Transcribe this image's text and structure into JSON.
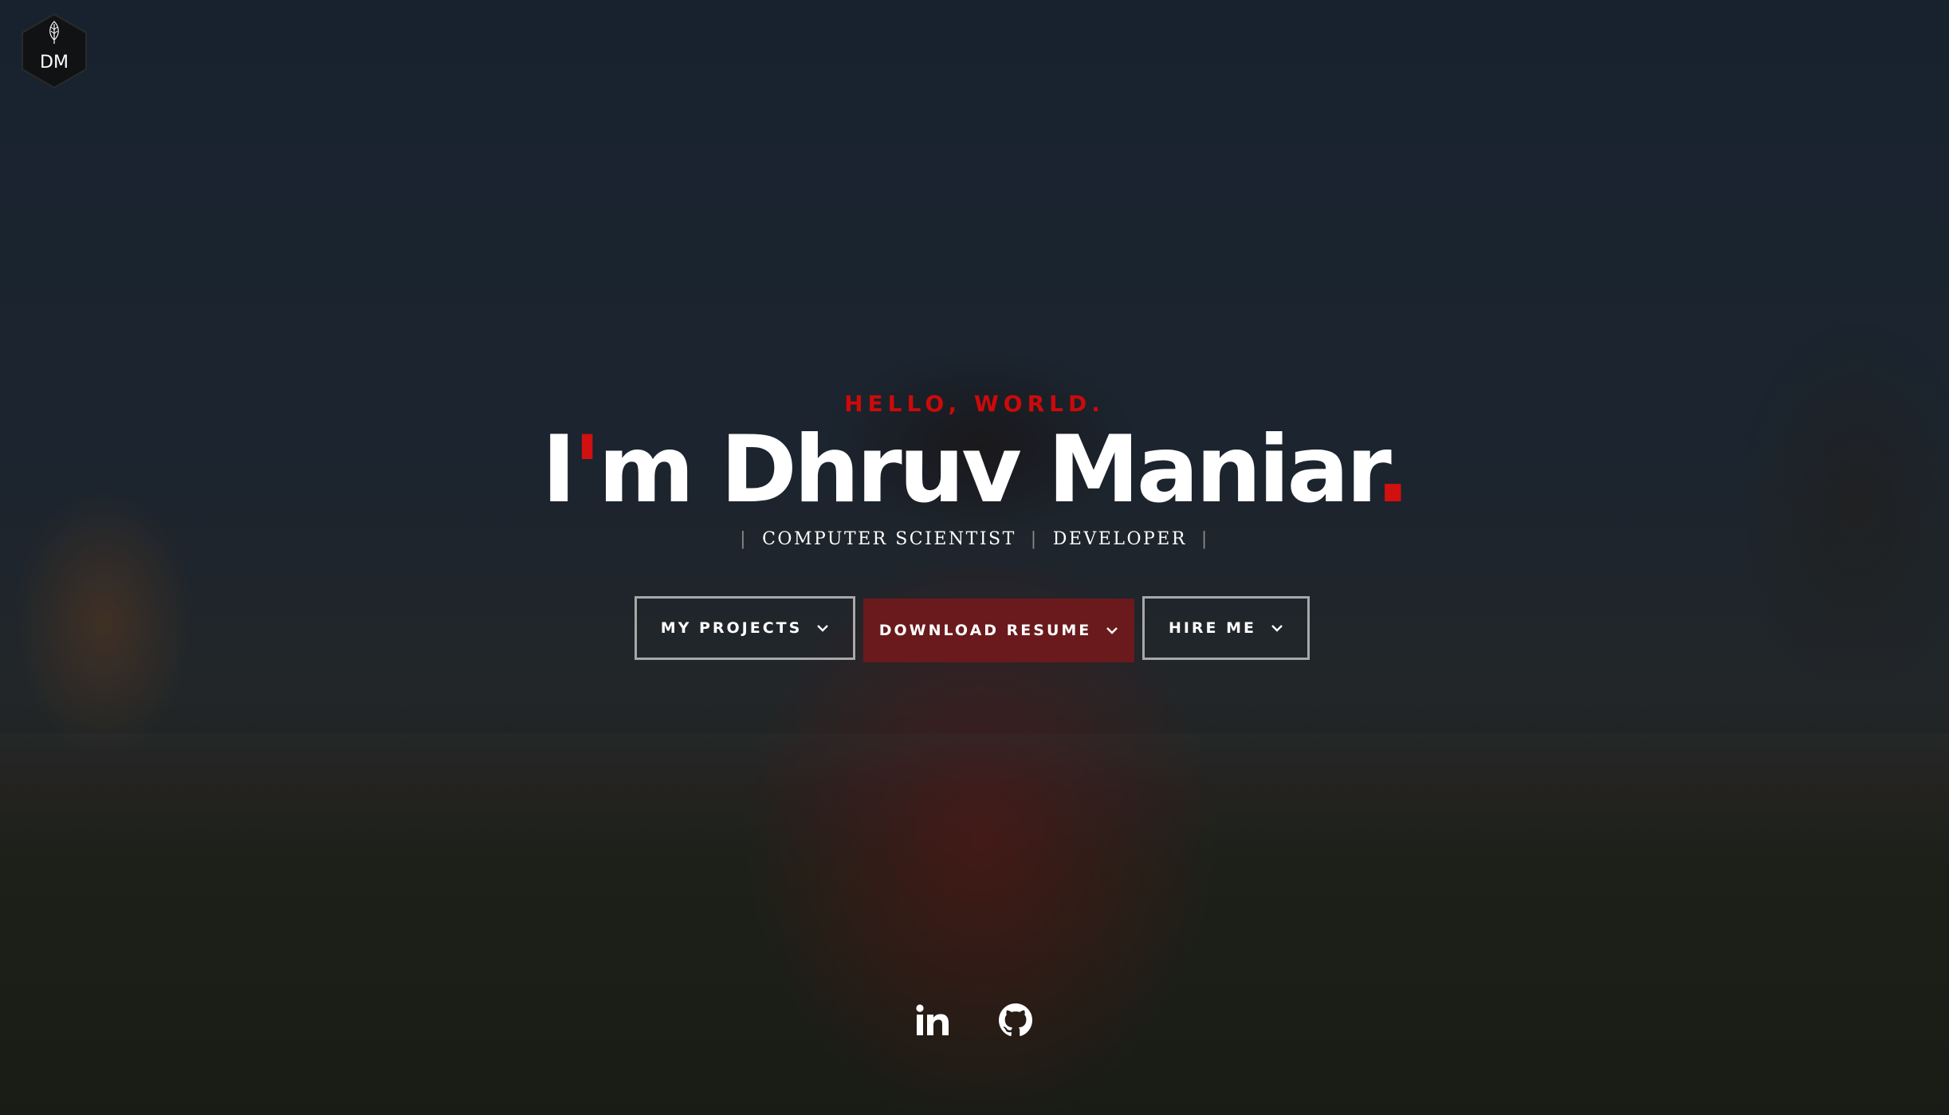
{
  "branding": {
    "logo_text": "DM",
    "logo_icon": "leaf-icon"
  },
  "hero": {
    "greeting": "HELLO, WORLD.",
    "headline_prefix": "I",
    "headline_apostrophe": "'",
    "headline_name": "m Dhruv Maniar",
    "headline_dot": ".",
    "roles": [
      "COMPUTER SCIENTIST",
      "DEVELOPER"
    ],
    "role_separator": "|"
  },
  "buttons": {
    "projects_label": "MY PROJECTS",
    "resume_label": "DOWNLOAD RESUME",
    "hire_label": "HIRE ME"
  },
  "social": {
    "linkedin_icon": "linkedin-icon",
    "github_icon": "github-icon"
  },
  "colors": {
    "accent": "#cc0a0a",
    "resume_button_bg": "#6a1a1c",
    "button_border": "#a8a8a8",
    "text": "#ffffff"
  }
}
